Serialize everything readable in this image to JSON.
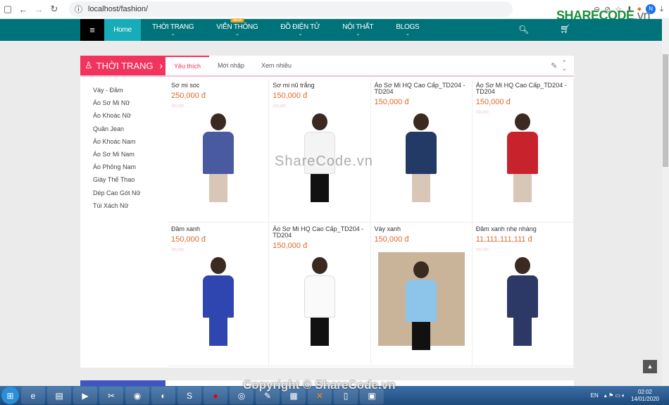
{
  "browser": {
    "url": "localhost/fashion/",
    "profile_initial": "N"
  },
  "logo": {
    "brand": "SHARECODE",
    "suffix": ".vn"
  },
  "nav": {
    "items": [
      {
        "label": "Home"
      },
      {
        "label": "THỜI TRANG"
      },
      {
        "label": "VIỄN THÔNG",
        "badge": "NEW"
      },
      {
        "label": "ĐỒ ĐIỆN TỬ"
      },
      {
        "label": "NỘI THẤT"
      },
      {
        "label": "BLOGS"
      }
    ]
  },
  "section": {
    "title": "THỜI TRANG",
    "tabs": [
      "Yêu thích",
      "Mới nhập",
      "Xem nhiều"
    ],
    "active_tab": "Yêu thích",
    "categories": [
      "Váy - Đầm",
      "Áo Sơ Mi Nữ",
      "Áo Khoác Nữ",
      "Quần Jean",
      "Áo Khoác Nam",
      "Áo Sơ Mi Nam",
      "Áo Phông Nam",
      "Giày Thể Thao",
      "Dép Cao Gót Nữ",
      "Túi Xách Nữ"
    ],
    "products": [
      {
        "name": "Sơ mi soc",
        "price": "250,000 đ",
        "old_price": "200,000"
      },
      {
        "name": "Sơ mi nũ trắng",
        "price": "150,000 đ",
        "old_price": "200,000"
      },
      {
        "name": "Áo Sơ Mi HQ Cao Cấp_TD204 - TD204",
        "price": "150,000 đ"
      },
      {
        "name": "Áo Sơ Mi HQ Cao Cấp_TD204 - TD204",
        "price": "150,000 đ",
        "old_price": "200,000"
      },
      {
        "name": "Đầm xanh",
        "price": "150,000 đ",
        "old_price": "200,000"
      },
      {
        "name": "Áo Sơ Mi HQ Cao Cấp_TD204 - TD204",
        "price": "150,000 đ"
      },
      {
        "name": "Váy xanh",
        "price": "150,000 đ"
      },
      {
        "name": "Đầm xanh nhẹ nhàng",
        "price": "11,111,111,111 đ",
        "old_price": "200,000"
      }
    ]
  },
  "watermark": "ShareCode.vn",
  "copyright": "Copyright © ShareCode.vn",
  "taskbar": {
    "lang": "EN",
    "time": "02:02",
    "date": "14/01/2020"
  },
  "colors": {
    "nav": "#00737a",
    "accent": "#f2335d",
    "price": "#e0672a"
  }
}
